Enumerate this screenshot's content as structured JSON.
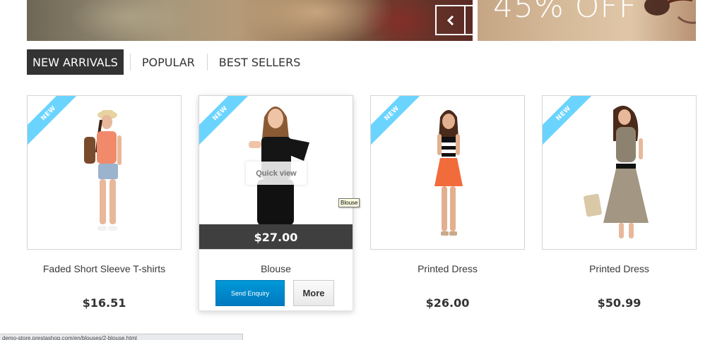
{
  "banner": {
    "left_image": "fashion-banner",
    "slider_prev_icon": "chevron-left-icon",
    "slider_next_icon": "chevron-right-icon",
    "offer_text": "45% OFF"
  },
  "tabs": [
    {
      "label": "New arrivals",
      "active": true
    },
    {
      "label": "Popular",
      "active": false
    },
    {
      "label": "Best Sellers",
      "active": false
    }
  ],
  "products": [
    {
      "name": "Faded Short Sleeve T-shirts",
      "price": "$16.51",
      "badge": "NEW"
    },
    {
      "name": "Blouse",
      "price": "$27.00",
      "badge": "NEW",
      "overlay_price": "$27.00",
      "quick_view_label": "Quick view",
      "enquiry_label": "Send Enquiry",
      "more_label": "More"
    },
    {
      "name": "Printed Dress",
      "price": "$26.00",
      "badge": "NEW"
    },
    {
      "name": "Printed Dress",
      "price": "$50.99",
      "badge": "NEW"
    }
  ],
  "tooltip": "Blouse",
  "status_url": "demo-store.prestashop.com/en/blouses/2-blouse.html",
  "colors": {
    "ribbon": "#6ad4ff",
    "accent": "#0088cc",
    "dark": "#333333"
  }
}
